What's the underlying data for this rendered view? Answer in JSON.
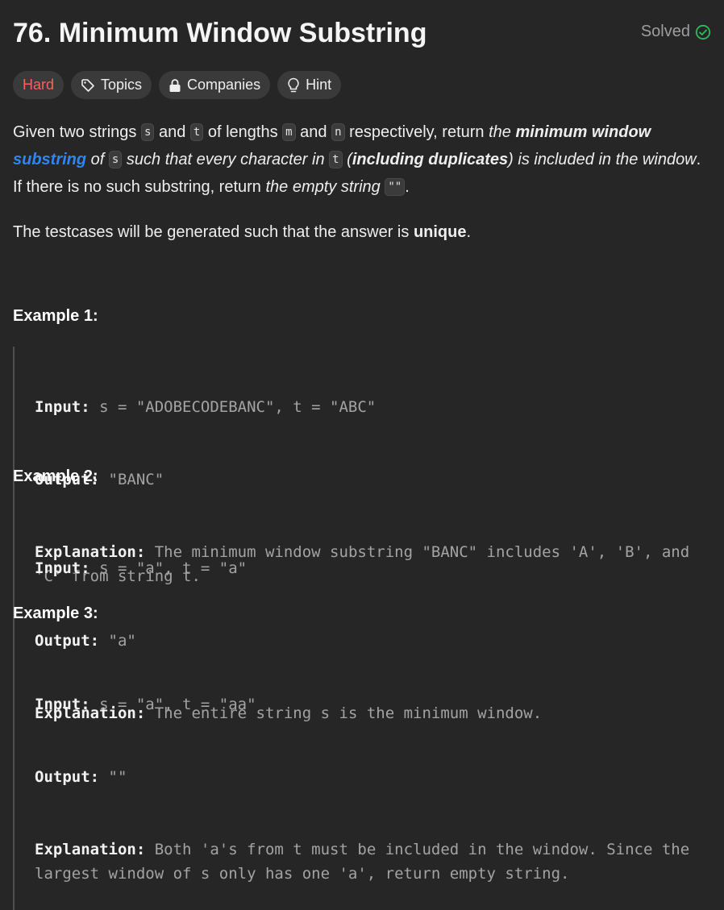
{
  "problem": {
    "title": "76. Minimum Window Substring",
    "status": "Solved",
    "tags": {
      "difficulty": "Hard",
      "topics": "Topics",
      "companies": "Companies",
      "hint": "Hint"
    }
  },
  "description": {
    "t1": "Given two strings ",
    "c_s": "s",
    "t2": " and ",
    "c_t": "t",
    "t3": " of lengths ",
    "c_m": "m",
    "t4": " and ",
    "c_n": "n",
    "t5": " respectively, return ",
    "i1": "the ",
    "b1": "minimum window",
    "link": "substring",
    "i2": " of ",
    "c_s2": "s",
    "i3": " such that every character in ",
    "c_t2": "t",
    "i4": " (",
    "b2": "including duplicates",
    "i5": ") is included in the window",
    "t6": ". If there is no such substring, return ",
    "i6": "the empty string ",
    "c_empty": "\"\"",
    "t7": ".",
    "p2_text": "The testcases will be generated such that the answer is ",
    "p2_bold": "unique",
    "p2_end": "."
  },
  "examples": [
    {
      "title": "Example 1:",
      "input_label": "Input:",
      "input": " s = \"ADOBECODEBANC\", t = \"ABC\"",
      "output_label": "Output:",
      "output": " \"BANC\"",
      "explanation_label": "Explanation:",
      "explanation": " The minimum window substring \"BANC\" includes 'A', 'B', and 'C' from string t."
    },
    {
      "title": "Example 2:",
      "input_label": "Input:",
      "input": " s = \"a\", t = \"a\"",
      "output_label": "Output:",
      "output": " \"a\"",
      "explanation_label": "Explanation:",
      "explanation": " The entire string s is the minimum window."
    },
    {
      "title": "Example 3:",
      "input_label": "Input:",
      "input": " s = \"a\", t = \"aa\"",
      "output_label": "Output:",
      "output": " \"\"",
      "explanation_label": "Explanation:",
      "explanation": " Both 'a's from t must be included in the window. Since the largest window of s only has one 'a', return empty string."
    }
  ],
  "colors": {
    "background": "#262626",
    "hard": "#f8615c",
    "solved_check": "#2cbb5d",
    "link": "#2f86f0"
  }
}
